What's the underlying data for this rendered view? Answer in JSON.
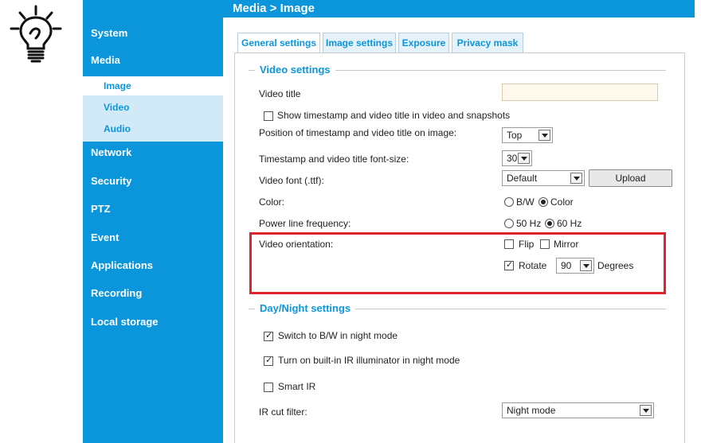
{
  "header": {
    "breadcrumb": "Media  > Image"
  },
  "sidebar": {
    "items": [
      {
        "label": "System"
      },
      {
        "label": "Media"
      },
      {
        "label": "Network"
      },
      {
        "label": "Security"
      },
      {
        "label": "PTZ"
      },
      {
        "label": "Event"
      },
      {
        "label": "Applications"
      },
      {
        "label": "Recording"
      },
      {
        "label": "Local storage"
      }
    ],
    "sub_items": [
      {
        "label": "Image"
      },
      {
        "label": "Video"
      },
      {
        "label": "Audio"
      }
    ]
  },
  "tabs": [
    {
      "label": "General settings"
    },
    {
      "label": "Image settings"
    },
    {
      "label": "Exposure"
    },
    {
      "label": "Privacy mask"
    }
  ],
  "video_settings": {
    "legend": "Video settings",
    "video_title_label": "Video title",
    "video_title_value": "",
    "show_timestamp_label": "Show timestamp and video title in video and snapshots",
    "show_timestamp_checked": false,
    "position_label": "Position of timestamp and video title on image:",
    "position_value": "Top",
    "font_size_label": "Timestamp and video title font-size:",
    "font_size_value": "30",
    "font_label": "Video font (.ttf):",
    "font_value": "Default",
    "upload_label": "Upload",
    "color_label": "Color:",
    "color_options": [
      "B/W",
      "Color"
    ],
    "color_selected": "Color",
    "power_label": "Power line frequency:",
    "power_options": [
      "50 Hz",
      "60 Hz"
    ],
    "power_selected": "60 Hz",
    "orientation_label": "Video orientation:",
    "flip_label": "Flip",
    "flip_checked": false,
    "mirror_label": "Mirror",
    "mirror_checked": false,
    "rotate_label": "Rotate",
    "rotate_checked": true,
    "rotate_value": "90",
    "degrees_label": "Degrees"
  },
  "day_night": {
    "legend": "Day/Night settings",
    "switch_bw_label": "Switch to B/W in night mode",
    "switch_bw_checked": true,
    "ir_illuminator_label": "Turn on built-in IR illuminator in night mode",
    "ir_illuminator_checked": true,
    "smart_ir_label": "Smart IR",
    "smart_ir_checked": false,
    "ir_cut_label": "IR cut filter:",
    "ir_cut_value": "Night mode"
  },
  "colors": {
    "accent": "#0b96dc",
    "highlight": "#e0242e"
  }
}
